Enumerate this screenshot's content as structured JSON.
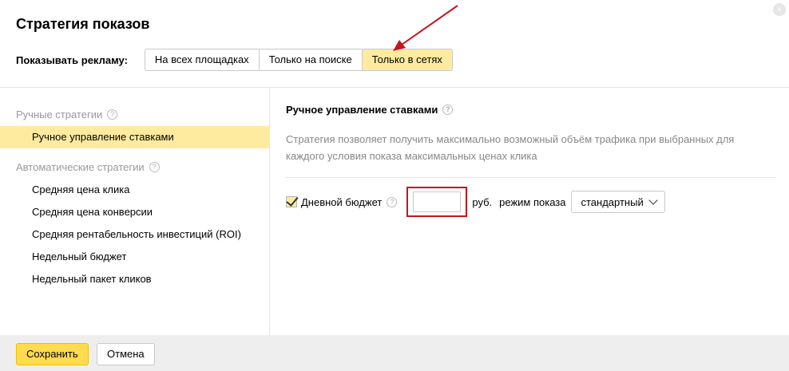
{
  "dialog": {
    "title": "Стратегия показов",
    "close_icon": "×"
  },
  "show_ads": {
    "label": "Показывать рекламу:",
    "options": [
      "На всех площадках",
      "Только на поиске",
      "Только в сетях"
    ],
    "selected": "Только в сетях"
  },
  "annotation": {
    "arrow_color": "#c4161c",
    "box_color": "#c4161c"
  },
  "sidebar": {
    "manual_group": "Ручные стратегии",
    "manual_items": [
      "Ручное управление ставками"
    ],
    "auto_group": "Автоматические стратегии",
    "auto_items": [
      "Средняя цена клика",
      "Средняя цена конверсии",
      "Средняя рентабельность инвестиций (ROI)",
      "Недельный бюджет",
      "Недельный пакет кликов"
    ],
    "active_item": "Ручное управление ставками"
  },
  "content": {
    "title": "Ручное управление ставками",
    "description": "Стратегия позволяет получить максимально возможный объём трафика при выбранных для каждого условия показа максимальных ценах клика",
    "daily_budget": {
      "checked": true,
      "label": "Дневной бюджет",
      "value": "",
      "currency": "руб.",
      "mode_label": "режим показа",
      "mode_value": "стандартный"
    }
  },
  "footer": {
    "save_label": "Сохранить",
    "cancel_label": "Отмена"
  },
  "colors": {
    "accent_yellow": "#ffdb4d",
    "selected_bg": "#ffeba0",
    "footer_bg": "#eeeeee"
  },
  "help_icon": "?"
}
